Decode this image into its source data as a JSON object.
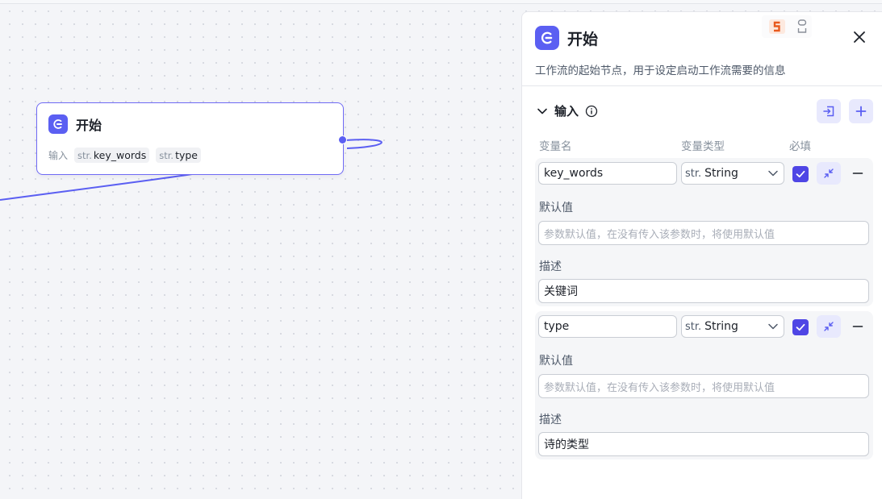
{
  "node": {
    "title": "开始",
    "inputs_label": "输入",
    "inputs": [
      {
        "prefix": "str.",
        "name": "key_words"
      },
      {
        "prefix": "str.",
        "name": "type"
      }
    ]
  },
  "panel": {
    "title": "开始",
    "description": "工作流的起始节点，用于设定启动工作流需要的信息",
    "section_title": "输入",
    "columns": {
      "name": "变量名",
      "type": "变量类型",
      "required": "必填"
    },
    "variables": [
      {
        "name": "key_words",
        "type_prefix": "str.",
        "type": "String",
        "required": true,
        "default_label": "默认值",
        "default_placeholder": "参数默认值，在没有传入该参数时，将使用默认值",
        "desc_label": "描述",
        "desc_value": "关键词"
      },
      {
        "name": "type",
        "type_prefix": "str.",
        "type": "String",
        "required": true,
        "default_label": "默认值",
        "default_placeholder": "参数默认值，在没有传入该参数时，将使用默认值",
        "desc_label": "描述",
        "desc_value": "诗的类型"
      }
    ]
  },
  "colors": {
    "accent": "#5b5ff2",
    "accent_light": "#e8e9fd",
    "checkbox": "#4f46e5"
  }
}
